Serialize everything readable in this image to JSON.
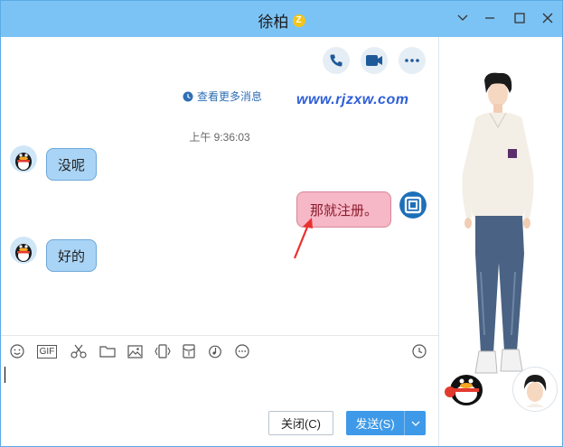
{
  "window": {
    "title": "徐柏",
    "title_badge": "Z",
    "controls": [
      "chevron-down-icon",
      "minimize-icon",
      "maximize-icon",
      "close-icon"
    ]
  },
  "chat": {
    "top_actions": [
      "phone-icon",
      "video-icon",
      "more-icon"
    ],
    "view_more_label": "查看更多消息",
    "watermark": "www.rjzxw.com",
    "timestamp": "上午 9:36:03",
    "messages": [
      {
        "from": "contact",
        "text": "没呢"
      },
      {
        "from": "me",
        "text": "那就注册。"
      },
      {
        "from": "contact",
        "text": "好的"
      }
    ]
  },
  "toolbar": {
    "gif_label": "GIF",
    "icons": [
      "emoji-icon",
      "gif-icon",
      "scissors-icon",
      "folder-icon",
      "image-icon",
      "shake-icon",
      "red-packet-icon",
      "music-icon",
      "more-dots-icon",
      "history-clock-icon"
    ]
  },
  "footer": {
    "close_label": "关闭(C)",
    "send_label": "发送(S)"
  },
  "colors": {
    "titlebar": "#7cc3f5",
    "bubble_in": "#a9d4f5",
    "bubble_out": "#f6b7c6",
    "send_button": "#3e9ae8",
    "annotation_arrow": "#e8312f"
  }
}
